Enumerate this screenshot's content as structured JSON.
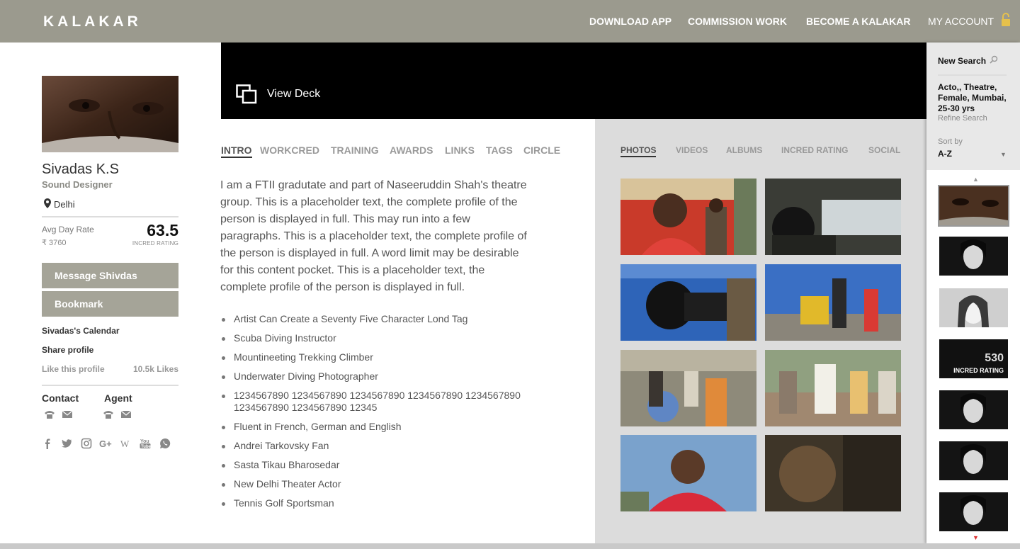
{
  "header": {
    "logo": "KALAKAR",
    "nav": [
      "DOWNLOAD APP",
      "COMMISSION WORK",
      "BECOME A KALAKAR"
    ],
    "account": "MY ACCOUNT"
  },
  "profile": {
    "name": "Sivadas K.S",
    "role": "Sound Designer",
    "location": "Delhi",
    "rate_label": "Avg Day Rate",
    "rate_value": "₹ 3760",
    "rating": "63.5",
    "rating_label": "INCRED RATING",
    "message_button": "Message Shivdas",
    "bookmark_button": "Bookmark",
    "calendar_link": "Sivadas's Calendar",
    "share_link": "Share profile",
    "like_link": "Like this profile",
    "likes": "10.5k Likes",
    "contact_title": "Contact",
    "agent_title": "Agent"
  },
  "banner": {
    "view_deck": "View Deck"
  },
  "tabs": [
    "INTRO",
    "WORKCRED",
    "TRAINING",
    "AWARDS",
    "LINKS",
    "TAGS",
    "CIRCLE"
  ],
  "intro_text": "I am a FTII gradutate and part of Naseeruddin Shah's theatre group. This is a placeholder text, the complete profile of the person is displayed in full. This may run into a few paragraphs. This is a placeholder text, the complete profile of the person is displayed in full. A word limit may be desirable for this content pocket. This is a placeholder text, the complete profile of the person is displayed in full.",
  "bullets": [
    "Artist Can Create a Seventy Five Character Lond Tag",
    "Scuba Diving Instructor",
    "Mountineeting Trekking Climber",
    "Underwater Diving Photographer",
    "1234567890 1234567890 1234567890 1234567890 1234567890 1234567890 1234567890 12345",
    "Fluent in French, German and English",
    "Andrei Tarkovsky Fan",
    "Sasta Tikau Bharosedar",
    "New Delhi Theater Actor",
    "Tennis Golf Sportsman"
  ],
  "gallery_tabs": [
    "PHOTOS",
    "VIDEOS",
    "ALBUMS",
    "INCRED RATING",
    "SOCIAL"
  ],
  "sidebar": {
    "new_search": "New Search",
    "criteria": "Acto,, Theatre, Female, Mumbai, 25-30 yrs",
    "refine": "Refine Search",
    "sort_label": "Sort by",
    "sort_value": "A-Z",
    "rating_thumb_value": "530",
    "rating_thumb_label": "INCRED RATING"
  },
  "colors": {
    "header_bg": "#9b9a8e",
    "button_bg": "#a5a498",
    "gallery_bg": "#dcdcdc",
    "banner_bg": "#000000",
    "accent_red": "#dd3333"
  }
}
